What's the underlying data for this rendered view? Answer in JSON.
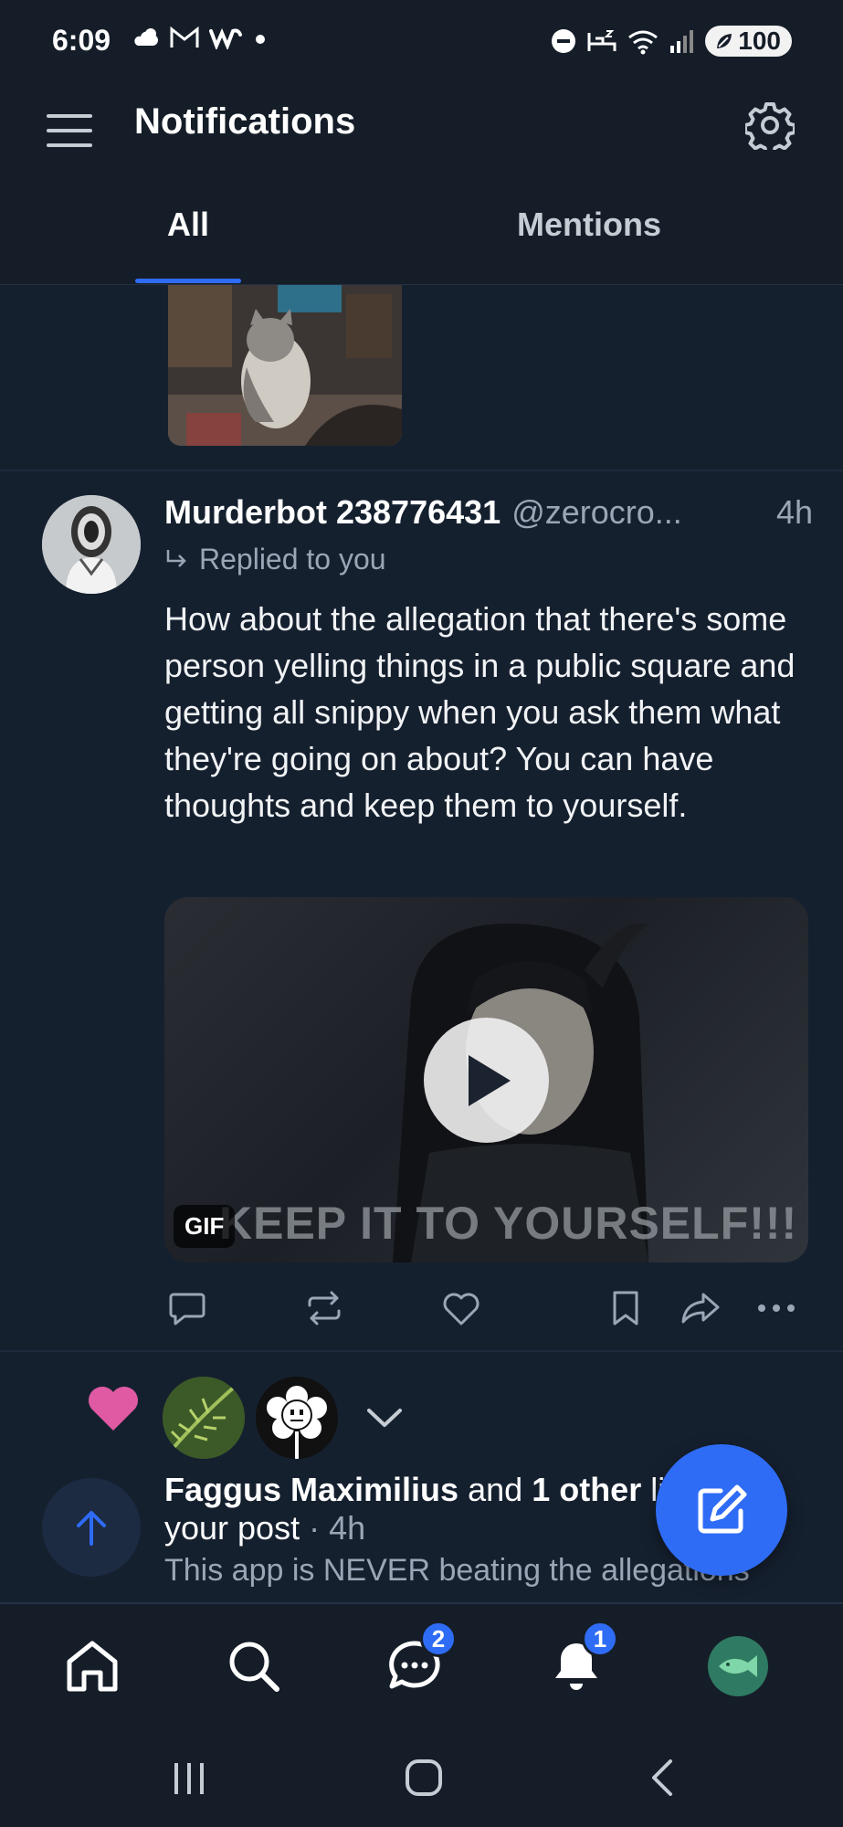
{
  "status_bar": {
    "time": "6:09",
    "battery": "100"
  },
  "header": {
    "title": "Notifications"
  },
  "tabs": [
    {
      "label": "All",
      "active": true
    },
    {
      "label": "Mentions",
      "active": false
    }
  ],
  "reply_notification": {
    "author_name": "Murderbot 238776431",
    "author_handle": "@zerocro...",
    "time": "4h",
    "reply_label": "Replied to you",
    "text": "How about the allegation that there's some person yelling things in a public square and getting all snippy when you ask them what they're going on about? You can have thoughts and keep them to yourself.",
    "gif": {
      "badge": "GIF",
      "caption": "KEEP IT TO YOURSELF!!!"
    }
  },
  "like_notification": {
    "name": "Faggus Maximilius",
    "and_text": "and",
    "others": "1 other",
    "rest": "liked",
    "line2": "your post",
    "time": "· 4h",
    "quote": "This app is NEVER beating the allegations"
  },
  "bottom_nav": {
    "chat_badge": "2",
    "notifications_badge": "1"
  },
  "colors": {
    "accent": "#2f6cf5",
    "background": "#151d28",
    "like_heart": "#e05aa3"
  }
}
